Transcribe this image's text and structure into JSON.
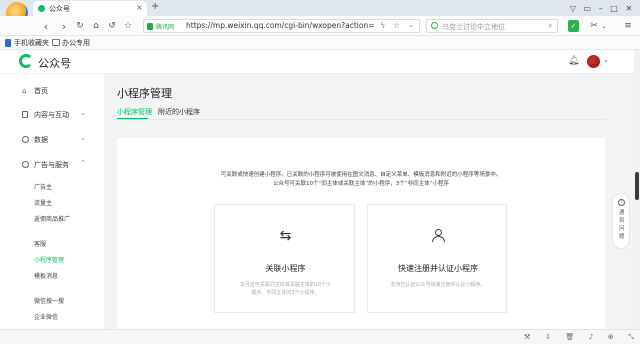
{
  "browser": {
    "tab_title": "公众号",
    "new_tab_symbol": "+",
    "site_badge": "腾讯网",
    "url": "https://mp.weixin.qq.com/cgi-bin/wxopen?action=",
    "search_placeholder": "乌克兰讨论中立地位",
    "bookmarks": [
      "手机收藏夹",
      "办公专用"
    ]
  },
  "header": {
    "logo_text": "公众号"
  },
  "sidebar": {
    "home": "首页",
    "content": "内容与互动",
    "data": "数据",
    "ads": "广告与服务",
    "ads_items": [
      "广告主",
      "流量主",
      "返佣商品推广"
    ],
    "other_items": [
      "客服",
      "小程序管理",
      "模板消息"
    ],
    "more_items": [
      "微信搜一搜",
      "企业微信"
    ],
    "active_item": "小程序管理"
  },
  "main": {
    "page_title": "小程序管理",
    "tabs": [
      "小程序管理",
      "附近的小程序"
    ],
    "desc_line1": "可关联或快速创建小程序。已关联的小程序可被使用在图文消息、自定义菜单、模板消息和附近的小程序等场景中。",
    "desc_line2": "公众号可关联10个“同主体或关联主体”的小程序，3个“非同主体”小程序",
    "card1": {
      "title": "关联小程序",
      "desc1": "本月还可关联同主体或关联主体的10个小",
      "desc2": "程序，不同主体的3个小程序。"
    },
    "card2": {
      "title": "快速注册并认证小程序",
      "desc": "支持已认证公众号快速注册并认证小程序。"
    }
  },
  "feedback": {
    "label": "遇到问题"
  },
  "colors": {
    "accent": "#07c160",
    "tabbar": "#dfe6ee"
  }
}
